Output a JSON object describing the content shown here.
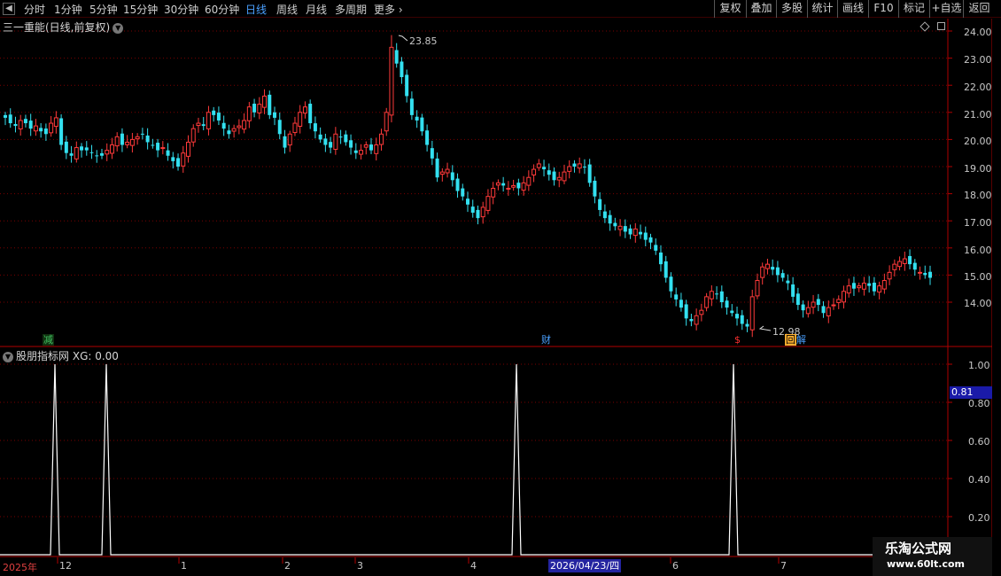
{
  "toolbar": {
    "timeframes": [
      "分时",
      "1分钟",
      "5分钟",
      "15分钟",
      "30分钟",
      "60分钟",
      "日线",
      "周线",
      "月线",
      "多周期",
      "更多"
    ],
    "active_timeframe": "日线",
    "right_buttons": [
      "复权",
      "叠加",
      "多股",
      "统计",
      "画线",
      "F10",
      "标记",
      "+自选",
      "返回"
    ]
  },
  "main_chart": {
    "title": "三一重能(日线,前复权)",
    "y_ticks": [
      "24.00",
      "23.00",
      "22.00",
      "21.00",
      "20.00",
      "19.00",
      "18.00",
      "17.00",
      "16.00",
      "15.00",
      "14.00"
    ],
    "high_label": "23.85",
    "low_label": "12.98",
    "event_markers": [
      {
        "text": "减",
        "color": "#40c060"
      },
      {
        "text": "财",
        "color": "#4aa0ff"
      },
      {
        "text": "$",
        "color": "#ff3030"
      },
      {
        "text": "回",
        "color": "#ffb030"
      },
      {
        "text": "解",
        "color": "#4aa0ff"
      }
    ]
  },
  "indicator": {
    "title": "股朋指标网",
    "xg_label": "XG: 0.00",
    "y_ticks": [
      "1.00",
      "0.80",
      "0.60",
      "0.40",
      "0.20"
    ],
    "current_value": "0.81"
  },
  "x_axis": {
    "year_label": "2025年",
    "month_ticks": [
      "12",
      "1",
      "2",
      "3",
      "4",
      "6",
      "7"
    ],
    "cursor_date": "2026/04/23/四"
  },
  "watermark": {
    "line1": "乐淘公式网",
    "line2": "www.60lt.com"
  },
  "colors": {
    "up": "#ff3a3a",
    "down": "#33e0f0",
    "grid": "#7a0000",
    "accent_blue": "#4aa0ff"
  },
  "chart_data": {
    "type": "candlestick",
    "ylim": [
      12.6,
      24.3
    ],
    "closes": [
      20.8,
      20.6,
      20.5,
      20.7,
      20.6,
      20.4,
      20.5,
      20.3,
      20.2,
      20.6,
      20.8,
      19.8,
      19.5,
      19.4,
      19.7,
      19.6,
      19.6,
      19.5,
      19.4,
      19.4,
      19.6,
      19.8,
      20.1,
      19.8,
      19.9,
      20.0,
      20.1,
      20.2,
      19.9,
      19.8,
      19.6,
      19.7,
      19.4,
      19.2,
      19.0,
      19.5,
      19.9,
      20.4,
      20.6,
      20.5,
      21.0,
      20.9,
      20.7,
      20.4,
      20.2,
      20.4,
      20.5,
      20.7,
      21.2,
      21.0,
      21.3,
      21.6,
      20.9,
      20.8,
      20.2,
      19.7,
      20.2,
      20.6,
      21.0,
      21.2,
      20.6,
      20.3,
      20.0,
      19.8,
      19.7,
      20.2,
      20.1,
      19.9,
      19.7,
      19.5,
      19.6,
      19.8,
      19.6,
      19.8,
      20.2,
      21.0,
      23.4,
      22.8,
      22.3,
      21.6,
      20.9,
      20.7,
      20.3,
      19.8,
      19.3,
      18.6,
      18.8,
      18.9,
      18.5,
      18.1,
      17.9,
      17.6,
      17.3,
      17.1,
      17.5,
      17.9,
      18.2,
      18.4,
      18.3,
      18.2,
      18.3,
      18.2,
      18.4,
      18.6,
      18.9,
      19.1,
      18.9,
      18.7,
      18.5,
      18.6,
      18.8,
      19.0,
      19.0,
      19.1,
      19.0,
      18.4,
      17.9,
      17.4,
      17.1,
      16.9,
      16.8,
      16.8,
      16.6,
      16.5,
      16.7,
      16.5,
      16.3,
      16.2,
      15.9,
      15.4,
      14.9,
      14.4,
      14.1,
      13.8,
      13.4,
      13.3,
      13.5,
      13.7,
      14.2,
      14.4,
      14.3,
      14.0,
      13.8,
      13.6,
      13.4,
      13.2,
      13.1,
      14.2,
      14.8,
      15.3,
      15.4,
      15.2,
      15.0,
      14.9,
      14.7,
      14.2,
      13.9,
      13.7,
      13.8,
      14.0,
      13.9,
      13.6,
      13.8,
      13.9,
      14.1,
      14.4,
      14.6,
      14.5,
      14.6,
      14.7,
      14.6,
      14.4,
      14.6,
      14.8,
      15.1,
      15.4,
      15.5,
      15.6,
      15.4,
      15.2,
      15.1,
      15.0,
      14.9
    ]
  }
}
